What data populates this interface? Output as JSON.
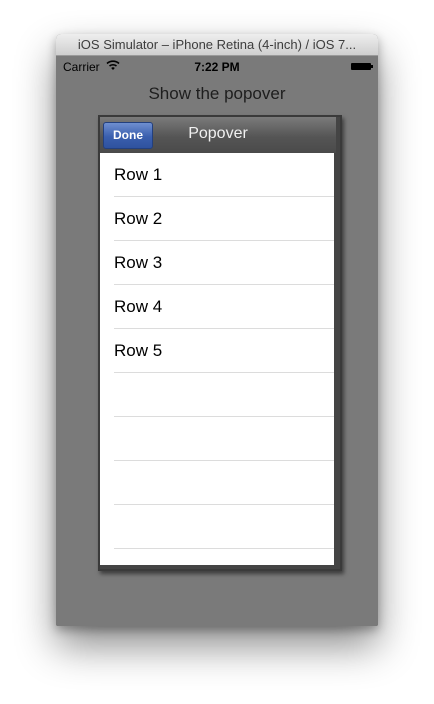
{
  "window": {
    "title": "iOS Simulator – iPhone Retina (4-inch) / iOS 7..."
  },
  "status_bar": {
    "carrier": "Carrier",
    "wifi_icon": "wifi-icon",
    "time": "7:22 PM",
    "battery_icon": "battery-icon"
  },
  "main": {
    "show_popover_label": "Show the popover"
  },
  "popover": {
    "title": "Popover",
    "done_label": "Done",
    "done_color": "#3a5fae",
    "rows": [
      {
        "label": "Row 1"
      },
      {
        "label": "Row 2"
      },
      {
        "label": "Row 3"
      },
      {
        "label": "Row 4"
      },
      {
        "label": "Row 5"
      }
    ]
  }
}
